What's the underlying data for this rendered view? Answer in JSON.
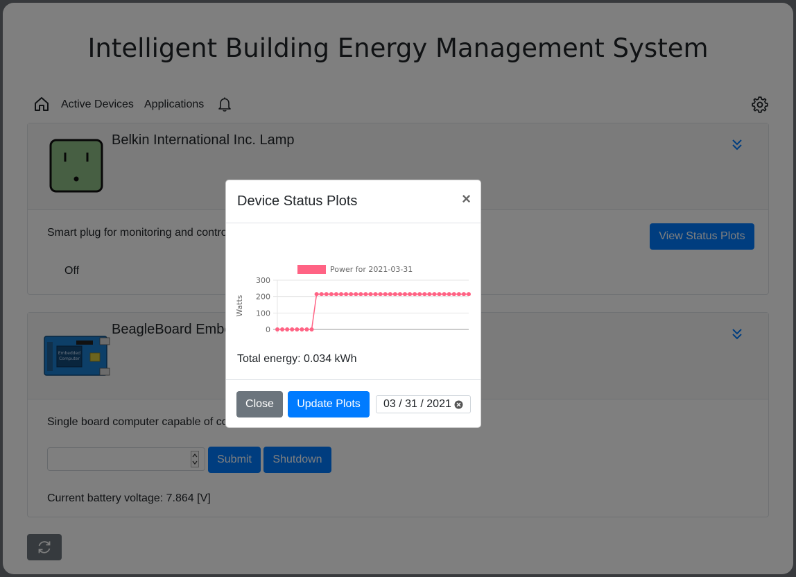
{
  "app": {
    "title": "Intelligent Building Energy Management System"
  },
  "nav": {
    "items": [
      "Active Devices",
      "Applications"
    ],
    "icons": [
      "home-icon",
      "bell-icon",
      "gear-icon"
    ]
  },
  "devices": [
    {
      "name": "Belkin International Inc. Lamp",
      "description": "Smart plug for monitoring and contro",
      "status": "Off",
      "button": "View Status Plots",
      "icon": "smart-plug-icon",
      "plug_color": "#8fbe86"
    },
    {
      "name": "BeagleBoard Embe",
      "description": "Single board computer capable of co",
      "board_label": "Embedded Computer",
      "input_value": "",
      "submit_label": "Submit",
      "shutdown_label": "Shutdown",
      "battery_text": "Current battery voltage: 7.864 [V]",
      "icon": "board-icon",
      "board_color": "#1b7fd0"
    }
  ],
  "refresh": {
    "icon": "refresh-icon"
  },
  "modal": {
    "title": "Device Status Plots",
    "close_glyph": "×",
    "energy_text": "Total energy: 0.034 kWh",
    "close_label": "Close",
    "update_label": "Update Plots",
    "date_value": "03 / 31 / 2021"
  },
  "chart_data": {
    "type": "line",
    "title": "",
    "xlabel": "",
    "ylabel": "Watts",
    "ylim": [
      0,
      300
    ],
    "yticks": [
      0,
      100,
      200,
      300
    ],
    "grid": true,
    "legend_position": "top",
    "series": [
      {
        "name": "Power for 2021-03-31",
        "color": "#ff6384",
        "values": [
          0,
          0,
          0,
          0,
          0,
          0,
          0,
          0,
          215,
          215,
          215,
          215,
          215,
          215,
          215,
          215,
          215,
          215,
          215,
          215,
          215,
          215,
          215,
          215,
          215,
          215,
          215,
          215,
          215,
          215,
          215,
          215,
          215,
          215,
          215,
          215,
          215,
          215,
          215,
          215
        ]
      }
    ]
  },
  "colors": {
    "primary": "#007bff",
    "secondary": "#6c757d",
    "text": "#212529"
  }
}
